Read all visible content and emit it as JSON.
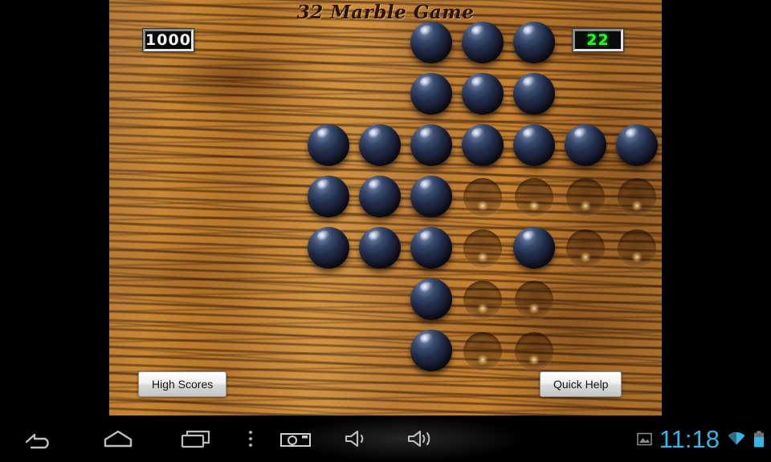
{
  "app": {
    "title": "32 Marble Game",
    "score_label": "1000",
    "marbles_remaining": "22"
  },
  "buttons": {
    "high_scores": "High Scores",
    "quick_help": "Quick Help"
  },
  "colors": {
    "board_wood": "#b5762f",
    "marble_dark": "#222c48",
    "score_text": "#f2f2f2",
    "count_text": "#33ee33",
    "clock_accent": "#33b5e5",
    "panel_bg": "#000000"
  },
  "board": {
    "rows": 7,
    "cols": 7,
    "shape": "cross",
    "legend": {
      "1": "marble",
      "0": "empty",
      "x": "off-board"
    },
    "cells": [
      [
        "x",
        "x",
        "1",
        "1",
        "1",
        "x",
        "x"
      ],
      [
        "x",
        "x",
        "1",
        "1",
        "1",
        "x",
        "x"
      ],
      [
        "1",
        "1",
        "1",
        "1",
        "1",
        "1",
        "1"
      ],
      [
        "1",
        "1",
        "1",
        "0",
        "0",
        "0",
        "0"
      ],
      [
        "1",
        "1",
        "1",
        "0",
        "1",
        "0",
        "0"
      ],
      [
        "x",
        "x",
        "1",
        "0",
        "0",
        "x",
        "x"
      ],
      [
        "x",
        "x",
        "1",
        "0",
        "0",
        "x",
        "x"
      ]
    ],
    "marble_count": 22,
    "empty_count": 11
  },
  "system_bar": {
    "clock": "11:18",
    "icons": [
      "back-icon",
      "home-icon",
      "recents-icon",
      "menu-dots-icon",
      "screenshot-camera-icon",
      "volume-down-icon",
      "volume-up-icon",
      "screenshot-notification-icon",
      "wifi-icon",
      "battery-icon"
    ]
  }
}
